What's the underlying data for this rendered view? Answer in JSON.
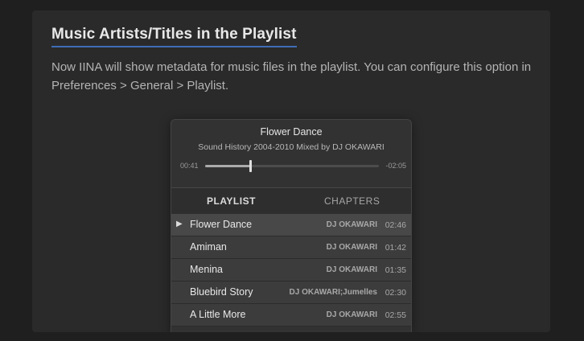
{
  "section": {
    "heading": "Music Artists/Titles in the Playlist",
    "description": "Now IINA will show metadata for music files in the playlist. You can configure this option in Preferences > General > Playlist."
  },
  "player": {
    "title": "Flower Dance",
    "subtitle": "Sound History 2004-2010 Mixed by DJ OKAWARI",
    "elapsed": "00:41",
    "remaining": "-02:05",
    "progress_fraction": 0.26,
    "tabs": {
      "playlist": "PLAYLIST",
      "chapters": "CHAPTERS",
      "active": "playlist"
    },
    "now_playing_icon": "play-triangle-icon",
    "now_playing_glyph": "▶",
    "playlist": [
      {
        "title": "Flower Dance",
        "artist": "DJ OKAWARI",
        "duration": "02:46",
        "playing": true
      },
      {
        "title": "Amiman",
        "artist": "DJ OKAWARI",
        "duration": "01:42",
        "playing": false
      },
      {
        "title": "Menina",
        "artist": "DJ OKAWARI",
        "duration": "01:35",
        "playing": false
      },
      {
        "title": "Bluebird Story",
        "artist": "DJ OKAWARI;Jumelles",
        "duration": "02:30",
        "playing": false
      },
      {
        "title": "A Little More",
        "artist": "DJ OKAWARI",
        "duration": "02:55",
        "playing": false
      }
    ]
  },
  "colors": {
    "page_background": "#1f1f1f",
    "card_background": "#2a2a2a",
    "heading_underline": "#3e6db5",
    "player_background": "#323232",
    "row_background": "#3c3c3c",
    "row_playing_background": "#484848"
  }
}
